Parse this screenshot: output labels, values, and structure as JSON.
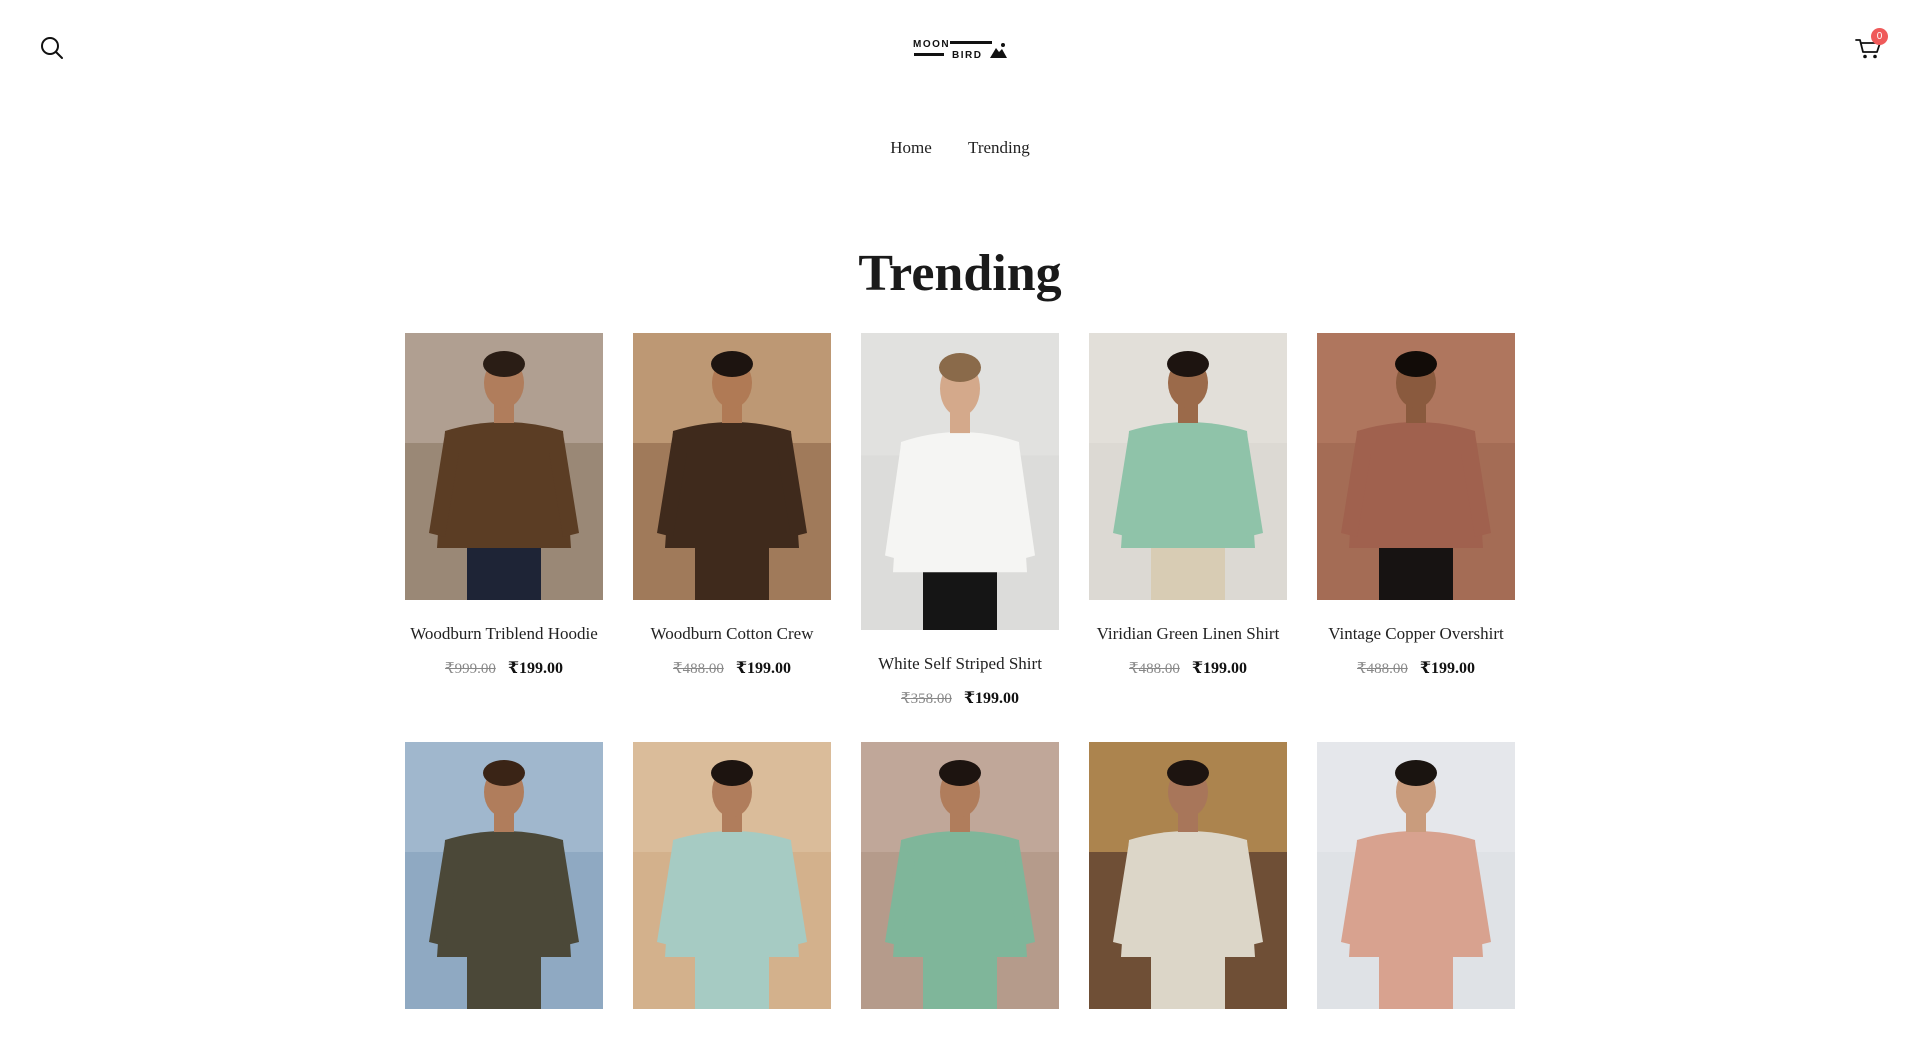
{
  "header": {
    "brand_line1": "MOON",
    "brand_line2": "BIRD",
    "cart_count": "0",
    "search_icon": "search-icon",
    "cart_icon": "cart-icon"
  },
  "nav": {
    "items": [
      {
        "label": "Home"
      },
      {
        "label": "Trending"
      }
    ]
  },
  "page": {
    "title": "Trending"
  },
  "products": [
    {
      "name": "Woodburn Triblend Hoodie",
      "old_price": "₹999.00",
      "price": "₹199.00",
      "bg": "#9a8876",
      "sky": "#b9aa9c",
      "shirt": "#5b3d24",
      "skin": "#b07d5c",
      "hair": "#2a1d15",
      "pants": "#1e2436"
    },
    {
      "name": "Woodburn Cotton Crew",
      "old_price": "₹488.00",
      "price": "₹199.00",
      "bg": "#a07a5a",
      "sky": "#c9a57f",
      "shirt": "#3f2a1c",
      "skin": "#b07a55",
      "hair": "#1d1410",
      "pants": "#3f2a1c"
    },
    {
      "name": "White Self Striped Shirt",
      "old_price": "₹358.00",
      "price": "₹199.00",
      "bg": "#dcdcda",
      "sky": "#e3e3e1",
      "shirt": "#f5f5f3",
      "skin": "#d4a98b",
      "hair": "#8a6a4a",
      "pants": "#151515"
    },
    {
      "name": "Viridian Green Linen Shirt",
      "old_price": "₹488.00",
      "price": "₹199.00",
      "bg": "#dcd9d3",
      "sky": "#e4e1dc",
      "shirt": "#8fc3a9",
      "skin": "#9b6a4a",
      "hair": "#1d1410",
      "pants": "#d8ccb4"
    },
    {
      "name": "Vintage Copper Overshirt",
      "old_price": "₹488.00",
      "price": "₹199.00",
      "bg": "#a46c55",
      "sky": "#b47a62",
      "shirt": "#a0614e",
      "skin": "#8a5a3e",
      "hair": "#120c08",
      "pants": "#171312"
    },
    {
      "name": "",
      "old_price": "",
      "price": "",
      "bg": "#8fa9c2",
      "sky": "#a7bdd1",
      "shirt": "#4b4838",
      "skin": "#b07d5c",
      "hair": "#3a2416",
      "pants": "#4b4838"
    },
    {
      "name": "",
      "old_price": "",
      "price": "",
      "bg": "#d3b18c",
      "sky": "#ddc09f",
      "shirt": "#a6cbc3",
      "skin": "#b07d5c",
      "hair": "#1d1410",
      "pants": "#a6cbc3"
    },
    {
      "name": "",
      "old_price": "",
      "price": "",
      "bg": "#b59b8b",
      "sky": "#c4ad9f",
      "shirt": "#7fb69a",
      "skin": "#b07d5c",
      "hair": "#1d1410",
      "pants": "#7fb69a"
    },
    {
      "name": "",
      "old_price": "",
      "price": "",
      "bg": "#6f4f36",
      "sky": "#c69b58",
      "shirt": "#dcd6c8",
      "skin": "#a8765a",
      "hair": "#1d1410",
      "pants": "#dcd6c8"
    },
    {
      "name": "",
      "old_price": "",
      "price": "",
      "bg": "#dfe2e6",
      "sky": "#e7e9ec",
      "shirt": "#d8a28f",
      "skin": "#c99c7d",
      "hair": "#1a1410",
      "pants": "#d8a28f"
    }
  ]
}
